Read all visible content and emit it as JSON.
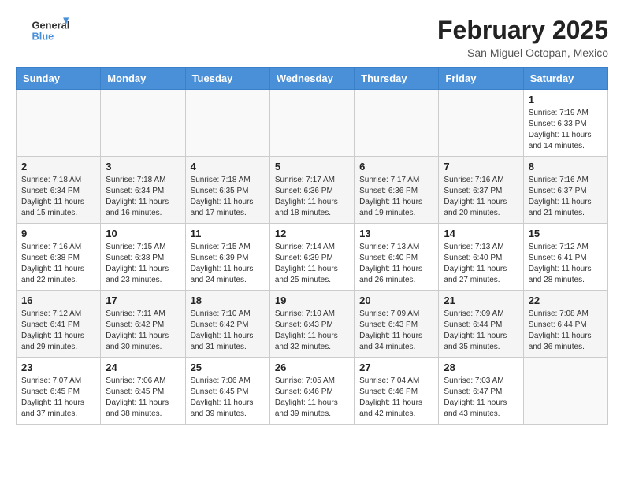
{
  "header": {
    "logo_general": "General",
    "logo_blue": "Blue",
    "month_title": "February 2025",
    "location": "San Miguel Octopan, Mexico"
  },
  "days_of_week": [
    "Sunday",
    "Monday",
    "Tuesday",
    "Wednesday",
    "Thursday",
    "Friday",
    "Saturday"
  ],
  "weeks": [
    [
      {
        "day": "",
        "info": ""
      },
      {
        "day": "",
        "info": ""
      },
      {
        "day": "",
        "info": ""
      },
      {
        "day": "",
        "info": ""
      },
      {
        "day": "",
        "info": ""
      },
      {
        "day": "",
        "info": ""
      },
      {
        "day": "1",
        "info": "Sunrise: 7:19 AM\nSunset: 6:33 PM\nDaylight: 11 hours\nand 14 minutes."
      }
    ],
    [
      {
        "day": "2",
        "info": "Sunrise: 7:18 AM\nSunset: 6:34 PM\nDaylight: 11 hours\nand 15 minutes."
      },
      {
        "day": "3",
        "info": "Sunrise: 7:18 AM\nSunset: 6:34 PM\nDaylight: 11 hours\nand 16 minutes."
      },
      {
        "day": "4",
        "info": "Sunrise: 7:18 AM\nSunset: 6:35 PM\nDaylight: 11 hours\nand 17 minutes."
      },
      {
        "day": "5",
        "info": "Sunrise: 7:17 AM\nSunset: 6:36 PM\nDaylight: 11 hours\nand 18 minutes."
      },
      {
        "day": "6",
        "info": "Sunrise: 7:17 AM\nSunset: 6:36 PM\nDaylight: 11 hours\nand 19 minutes."
      },
      {
        "day": "7",
        "info": "Sunrise: 7:16 AM\nSunset: 6:37 PM\nDaylight: 11 hours\nand 20 minutes."
      },
      {
        "day": "8",
        "info": "Sunrise: 7:16 AM\nSunset: 6:37 PM\nDaylight: 11 hours\nand 21 minutes."
      }
    ],
    [
      {
        "day": "9",
        "info": "Sunrise: 7:16 AM\nSunset: 6:38 PM\nDaylight: 11 hours\nand 22 minutes."
      },
      {
        "day": "10",
        "info": "Sunrise: 7:15 AM\nSunset: 6:38 PM\nDaylight: 11 hours\nand 23 minutes."
      },
      {
        "day": "11",
        "info": "Sunrise: 7:15 AM\nSunset: 6:39 PM\nDaylight: 11 hours\nand 24 minutes."
      },
      {
        "day": "12",
        "info": "Sunrise: 7:14 AM\nSunset: 6:39 PM\nDaylight: 11 hours\nand 25 minutes."
      },
      {
        "day": "13",
        "info": "Sunrise: 7:13 AM\nSunset: 6:40 PM\nDaylight: 11 hours\nand 26 minutes."
      },
      {
        "day": "14",
        "info": "Sunrise: 7:13 AM\nSunset: 6:40 PM\nDaylight: 11 hours\nand 27 minutes."
      },
      {
        "day": "15",
        "info": "Sunrise: 7:12 AM\nSunset: 6:41 PM\nDaylight: 11 hours\nand 28 minutes."
      }
    ],
    [
      {
        "day": "16",
        "info": "Sunrise: 7:12 AM\nSunset: 6:41 PM\nDaylight: 11 hours\nand 29 minutes."
      },
      {
        "day": "17",
        "info": "Sunrise: 7:11 AM\nSunset: 6:42 PM\nDaylight: 11 hours\nand 30 minutes."
      },
      {
        "day": "18",
        "info": "Sunrise: 7:10 AM\nSunset: 6:42 PM\nDaylight: 11 hours\nand 31 minutes."
      },
      {
        "day": "19",
        "info": "Sunrise: 7:10 AM\nSunset: 6:43 PM\nDaylight: 11 hours\nand 32 minutes."
      },
      {
        "day": "20",
        "info": "Sunrise: 7:09 AM\nSunset: 6:43 PM\nDaylight: 11 hours\nand 34 minutes."
      },
      {
        "day": "21",
        "info": "Sunrise: 7:09 AM\nSunset: 6:44 PM\nDaylight: 11 hours\nand 35 minutes."
      },
      {
        "day": "22",
        "info": "Sunrise: 7:08 AM\nSunset: 6:44 PM\nDaylight: 11 hours\nand 36 minutes."
      }
    ],
    [
      {
        "day": "23",
        "info": "Sunrise: 7:07 AM\nSunset: 6:45 PM\nDaylight: 11 hours\nand 37 minutes."
      },
      {
        "day": "24",
        "info": "Sunrise: 7:06 AM\nSunset: 6:45 PM\nDaylight: 11 hours\nand 38 minutes."
      },
      {
        "day": "25",
        "info": "Sunrise: 7:06 AM\nSunset: 6:45 PM\nDaylight: 11 hours\nand 39 minutes."
      },
      {
        "day": "26",
        "info": "Sunrise: 7:05 AM\nSunset: 6:46 PM\nDaylight: 11 hours\nand 39 minutes."
      },
      {
        "day": "27",
        "info": "Sunrise: 7:04 AM\nSunset: 6:46 PM\nDaylight: 11 hours\nand 42 minutes."
      },
      {
        "day": "28",
        "info": "Sunrise: 7:03 AM\nSunset: 6:47 PM\nDaylight: 11 hours\nand 43 minutes."
      },
      {
        "day": "",
        "info": ""
      }
    ]
  ]
}
